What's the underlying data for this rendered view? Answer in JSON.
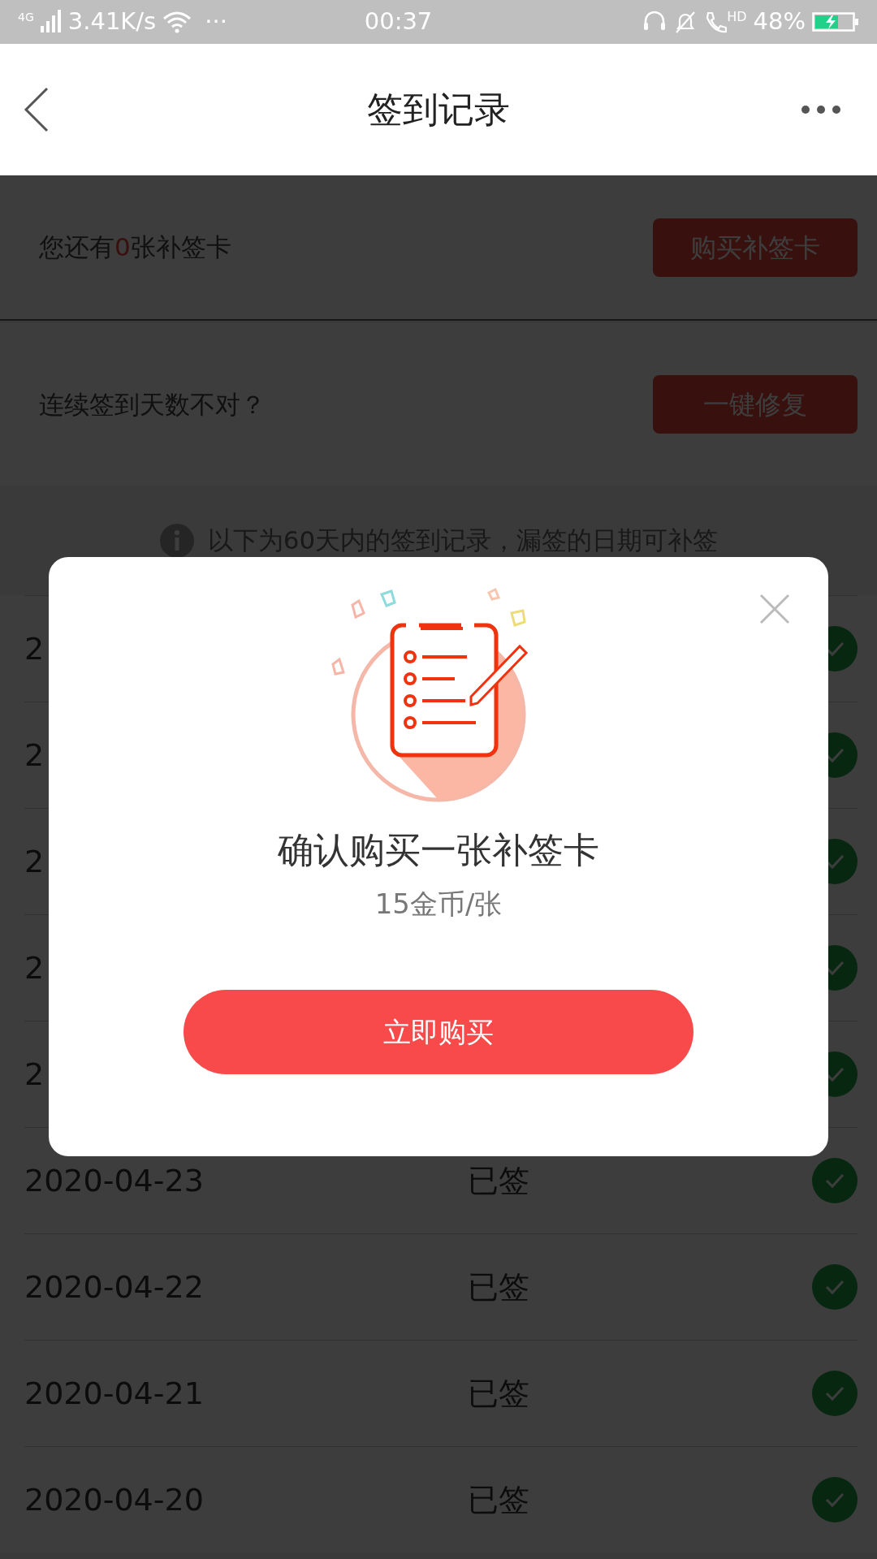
{
  "status_bar": {
    "network": "4G",
    "speed": "3.41K/s",
    "more": "···",
    "time": "00:37",
    "call_label": "HD",
    "battery": "48%"
  },
  "header": {
    "title": "签到记录"
  },
  "card_balance": {
    "text_before": "您还有",
    "count": "0",
    "text_after": "张补签卡",
    "button": "购买补签卡"
  },
  "card_repair": {
    "text": "连续签到天数不对？",
    "button": "一键修复"
  },
  "notice": "以下为60天内的签到记录，漏签的日期可补签",
  "records": [
    {
      "date": "2",
      "signed": true
    },
    {
      "date": "2",
      "signed": true
    },
    {
      "date": "2",
      "signed": true
    },
    {
      "date": "2",
      "signed": true
    },
    {
      "date": "2",
      "signed": true
    },
    {
      "date": "2020-04-23",
      "status": "已签",
      "signed": true
    },
    {
      "date": "2020-04-22",
      "status": "已签",
      "signed": true
    },
    {
      "date": "2020-04-21",
      "status": "已签",
      "signed": true
    },
    {
      "date": "2020-04-20",
      "status": "已签",
      "signed": true
    }
  ],
  "dialog": {
    "title": "确认购买一张补签卡",
    "price": "15金币/张",
    "button": "立即购买"
  }
}
